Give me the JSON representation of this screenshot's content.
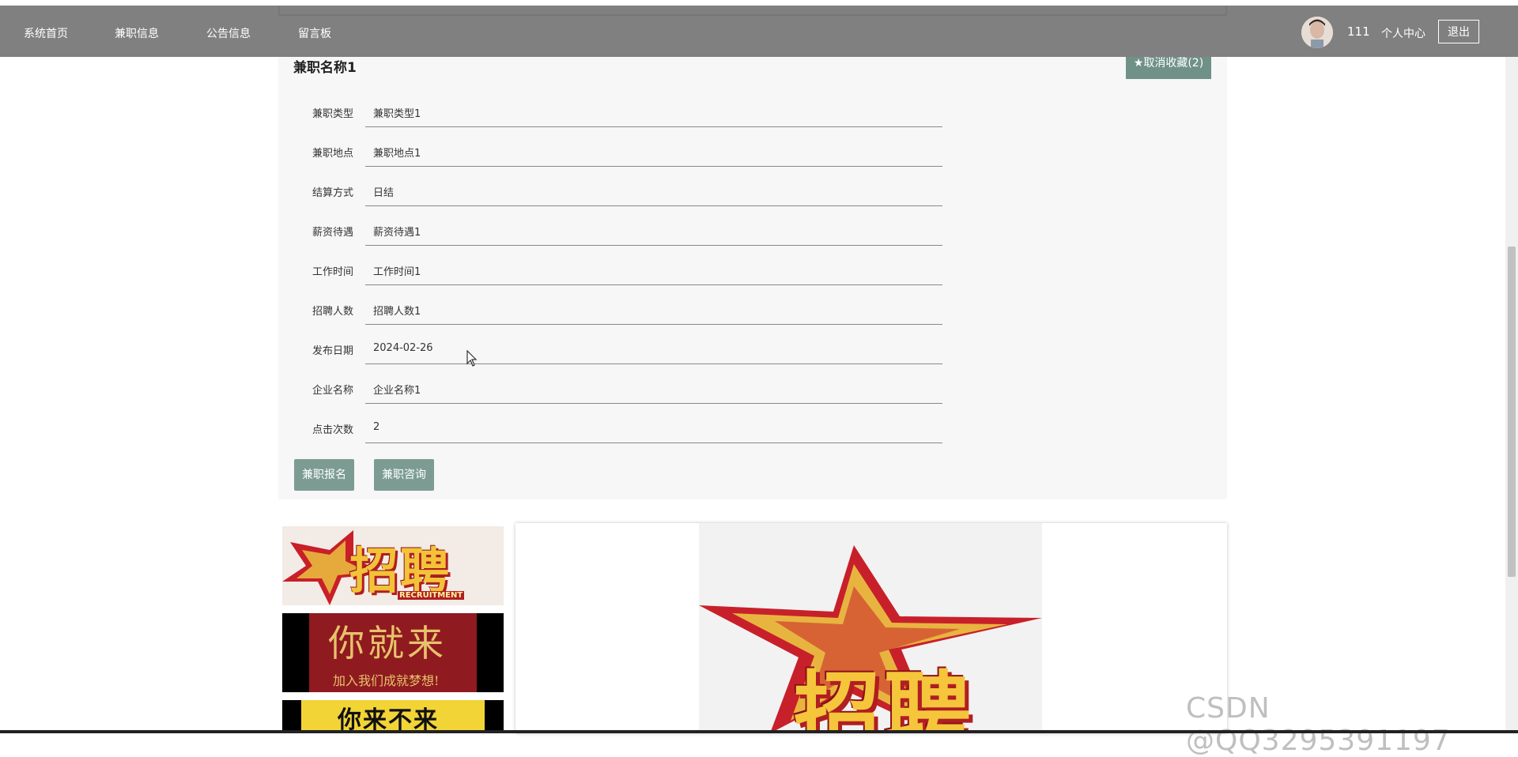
{
  "nav": {
    "items": [
      "系统首页",
      "兼职信息",
      "公告信息",
      "留言板"
    ],
    "user_name": "111",
    "user_center": "个人中心",
    "logout": "退出"
  },
  "detail": {
    "title": "兼职名称1",
    "favorite_button": "★取消收藏(2)",
    "fields": [
      {
        "label": "兼职类型",
        "value": "兼职类型1"
      },
      {
        "label": "兼职地点",
        "value": "兼职地点1"
      },
      {
        "label": "结算方式",
        "value": "日结"
      },
      {
        "label": "薪资待遇",
        "value": "薪资待遇1"
      },
      {
        "label": "工作时间",
        "value": "工作时间1"
      },
      {
        "label": "招聘人数",
        "value": "招聘人数1"
      },
      {
        "label": "发布日期",
        "value": "2024-02-26"
      },
      {
        "label": "企业名称",
        "value": "企业名称1"
      },
      {
        "label": "点击次数",
        "value": "2"
      }
    ],
    "apply_button": "兼职报名",
    "consult_button": "兼职咨询"
  },
  "images": {
    "thumb1_text": "招聘",
    "thumb1_sub": "RECRUITMENT",
    "thumb2_text": "你就来",
    "thumb2_sub": "加入我们成就梦想!",
    "thumb3_text": "你来不来",
    "main_text": "招聘"
  },
  "watermark": "CSDN @QQ3295391197",
  "colors": {
    "nav_bg": "#808080",
    "button_bg": "#7c9c93",
    "favorite_bg": "#6f9188",
    "panel_bg": "#f7f7f7"
  }
}
